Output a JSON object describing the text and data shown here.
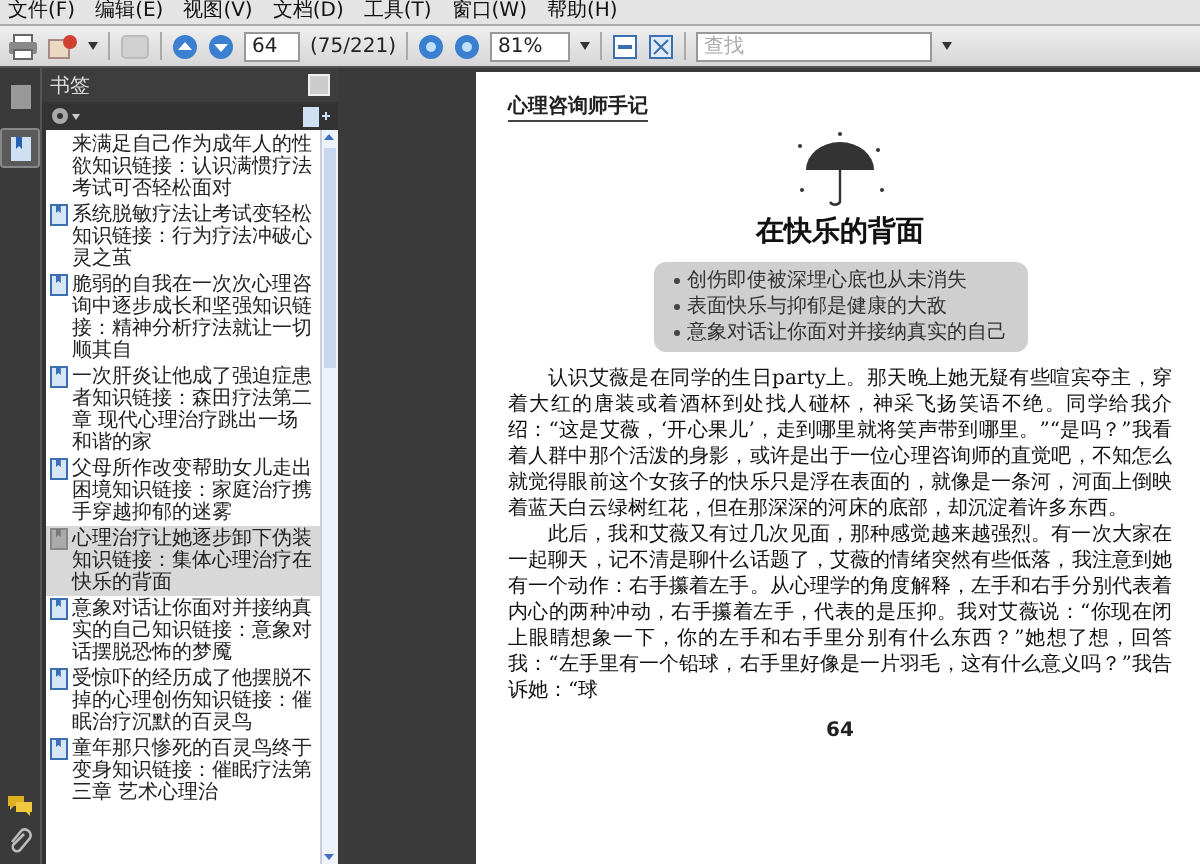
{
  "menu": [
    "文件(F)",
    "编辑(E)",
    "视图(V)",
    "文档(D)",
    "工具(T)",
    "窗口(W)",
    "帮助(H)"
  ],
  "toolbar": {
    "page": "64",
    "page_count": "(75/221)",
    "zoom": "81%",
    "find_placeholder": "查找"
  },
  "side_tabs": [
    {
      "kind": "pages",
      "selected": false
    },
    {
      "kind": "bookmarks",
      "selected": true
    }
  ],
  "bookmarks": {
    "title": "书签",
    "items": [
      {
        "text": "来满足自己作为成年人的性欲知识链接：认识满惯疗法考试可否轻松面对",
        "selected": false,
        "icon": false
      },
      {
        "text": "系统脱敏疗法让考试变轻松知识链接：行为疗法冲破心灵之茧",
        "selected": false,
        "icon": true
      },
      {
        "text": "脆弱的自我在一次次心理咨询中逐步成长和坚强知识链接：精神分析疗法就让一切顺其自",
        "selected": false,
        "icon": true
      },
      {
        "text": "一次肝炎让他成了强迫症患者知识链接：森田疗法第二章 现代心理治疗跳出一场和谐的家",
        "selected": false,
        "icon": true
      },
      {
        "text": "父母所作改变帮助女儿走出困境知识链接：家庭治疗携手穿越抑郁的迷雾",
        "selected": false,
        "icon": true
      },
      {
        "text": "心理治疗让她逐步卸下伪装知识链接：集体心理治疗在快乐的背面",
        "selected": true,
        "icon": true
      },
      {
        "text": "意象对话让你面对并接纳真实的自己知识链接：意象对话摆脱恐怖的梦魇",
        "selected": false,
        "icon": true
      },
      {
        "text": "受惊吓的经历成了他摆脱不掉的心理创伤知识链接：催眠治疗沉默的百灵鸟",
        "selected": false,
        "icon": true
      },
      {
        "text": "童年那只惨死的百灵鸟终于变身知识链接：催眠疗法第三章 艺术心理治",
        "selected": false,
        "icon": true
      }
    ]
  },
  "document": {
    "running_head": "心理咨询师手记",
    "title": "在快乐的背面",
    "highlights": [
      "创伤即使被深埋心底也从未消失",
      "表面快乐与抑郁是健康的大敌",
      "意象对话让你面对并接纳真实的自己"
    ],
    "paragraphs": [
      "认识艾薇是在同学的生日party上。那天晚上她无疑有些喧宾夺主，穿着大红的唐装或着酒杯到处找人碰杯，神采飞扬笑语不绝。同学给我介绍：“这是艾薇，‘开心果儿’，走到哪里就将笑声带到哪里。”“是吗？”我看着人群中那个活泼的身影，或许是出于一位心理咨询师的直觉吧，不知怎么就觉得眼前这个女孩子的快乐只是浮在表面的，就像是一条河，河面上倒映着蓝天白云绿树红花，但在那深深的河床的底部，却沉淀着许多东西。",
      "此后，我和艾薇又有过几次见面，那种感觉越来越强烈。有一次大家在一起聊天，记不清是聊什么话题了，艾薇的情绪突然有些低落，我注意到她有一个动作：右手攥着左手。从心理学的角度解释，左手和右手分别代表着内心的两种冲动，右手攥着左手，代表的是压抑。我对艾薇说：“你现在闭上眼睛想象一下，你的左手和右手里分别有什么东西？”她想了想，回答我：“左手里有一个铅球，右手里好像是一片羽毛，这有什么意义吗？”我告诉她：“球"
    ],
    "page_number": "64"
  }
}
